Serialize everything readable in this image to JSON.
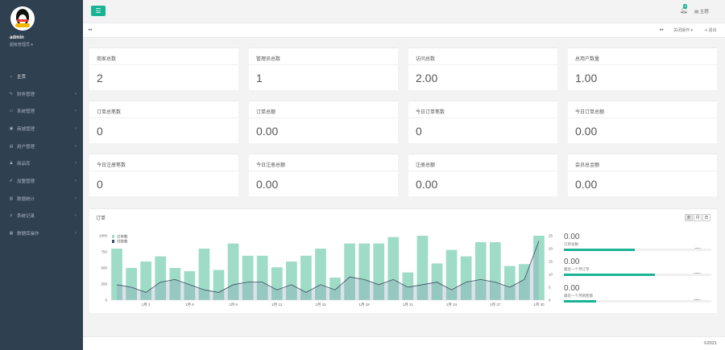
{
  "sidebar": {
    "user": {
      "name": "admin",
      "role": "超级管理员 ▾"
    },
    "items": [
      {
        "label": "主页",
        "icon": "home-icon",
        "glyph": "⌂",
        "has_arrow": false
      },
      {
        "label": "财务管理",
        "icon": "edit-icon",
        "glyph": "✎",
        "has_arrow": true
      },
      {
        "label": "系统管理",
        "icon": "desktop-icon",
        "glyph": "▭",
        "has_arrow": true
      },
      {
        "label": "商城管理",
        "icon": "shopping-icon",
        "glyph": "▣",
        "has_arrow": true
      },
      {
        "label": "用户管理",
        "icon": "table-icon",
        "glyph": "▤",
        "has_arrow": true
      },
      {
        "label": "商品库",
        "icon": "user-icon",
        "glyph": "♟",
        "has_arrow": true
      },
      {
        "label": "加盟管理",
        "icon": "pencil-icon",
        "glyph": "✐",
        "has_arrow": true
      },
      {
        "label": "数据统计",
        "icon": "chart-icon",
        "glyph": "▥",
        "has_arrow": true
      },
      {
        "label": "系统记录",
        "icon": "list-icon",
        "glyph": "≡",
        "has_arrow": true
      },
      {
        "label": "数据库操作",
        "icon": "database-icon",
        "glyph": "▦",
        "has_arrow": true
      }
    ]
  },
  "topbar": {
    "menu_icon": "☰",
    "badge": "8",
    "theme_label": "主题"
  },
  "tabbar": {
    "back": "◂◂",
    "forward": "▸▸",
    "close_ops": "关闭操作 ▾",
    "logout": "退出"
  },
  "cards": [
    {
      "title": "商家总数",
      "value": "2"
    },
    {
      "title": "管理员总数",
      "value": "1"
    },
    {
      "title": "访问总数",
      "value": "2.00"
    },
    {
      "title": "总用户数量",
      "value": "1.00"
    },
    {
      "title": "订单总笔数",
      "value": "0"
    },
    {
      "title": "订单总额",
      "value": "0.00"
    },
    {
      "title": "今日订单笔数",
      "value": "0"
    },
    {
      "title": "今日订单总额",
      "value": "0.00"
    },
    {
      "title": "今日注册笔数",
      "value": "0"
    },
    {
      "title": "今日注册总额",
      "value": "0.00"
    },
    {
      "title": "注册总额",
      "value": "0.00"
    },
    {
      "title": "会员总金额",
      "value": "0.00"
    }
  ],
  "order_panel": {
    "title": "订单",
    "segments": [
      "天",
      "月",
      "年"
    ],
    "stats": [
      {
        "value": "0.00",
        "label": "订单总数",
        "percent": "48%",
        "fraction": 0.48
      },
      {
        "value": "0.00",
        "label": "最近一个月订单",
        "percent": "62%",
        "fraction": 0.62
      },
      {
        "value": "0.00",
        "label": "最近一个月销售额",
        "percent": "22%",
        "fraction": 0.22
      }
    ]
  },
  "chart_data": {
    "type": "bar",
    "legend": [
      "订单数",
      "付款数"
    ],
    "x_ticks": [
      "1月 3",
      "1月 6",
      "1月 9",
      "1月 12",
      "1月 15",
      "1月 18",
      "1月 21",
      "1月 24",
      "1月 27",
      "1月 30"
    ],
    "y_left_ticks": [
      "0",
      "250",
      "500",
      "750",
      "1000"
    ],
    "y_right_ticks": [
      "0",
      "5",
      "10",
      "15",
      "20",
      "25"
    ],
    "ylim_left": [
      0,
      1000
    ],
    "ylim_right": [
      0,
      25
    ],
    "bars": [
      800,
      500,
      600,
      680,
      500,
      450,
      800,
      470,
      880,
      690,
      690,
      510,
      600,
      690,
      800,
      350,
      880,
      880,
      880,
      980,
      430,
      1000,
      570,
      780,
      680,
      900,
      900,
      530,
      560,
      1000
    ],
    "line": [
      6,
      5,
      3,
      7,
      8,
      6,
      4,
      3,
      6,
      7,
      7,
      4,
      6,
      3,
      6,
      4,
      9,
      8,
      6,
      8,
      5,
      6,
      7,
      4,
      7,
      8,
      7,
      5,
      8,
      23
    ]
  },
  "colors": {
    "accent": "#1ab394",
    "sidebar": "#2f4050",
    "bar": "#9fdcc8",
    "line": "#3a4b5e"
  },
  "footer": {
    "text": "©2021"
  }
}
